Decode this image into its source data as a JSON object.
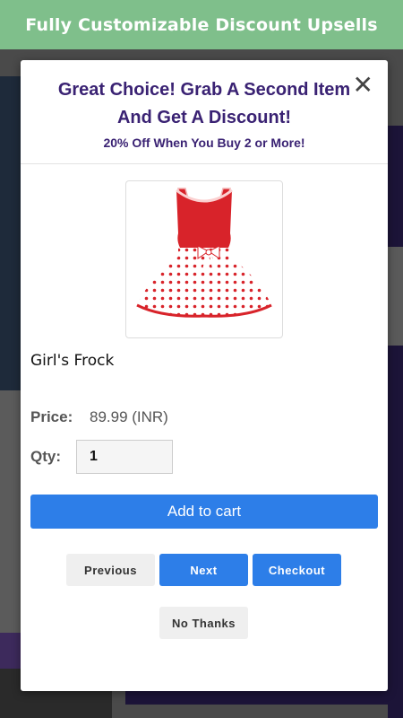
{
  "banner": {
    "title": "Fully Customizable Discount Upsells"
  },
  "modal": {
    "close_symbol": "✕",
    "headline": "Great Choice! Grab A Second Item And Get A Discount!",
    "subline": "20% Off When You Buy 2 or More!",
    "product": {
      "name": "Girl's Frock",
      "image_icon": "girls-frock-image",
      "price_label": "Price:",
      "price_value": "89.99 (INR)",
      "qty_label": "Qty:",
      "qty_value": "1"
    },
    "buttons": {
      "add_to_cart": "Add to cart",
      "previous": "Previous",
      "next": "Next",
      "checkout": "Checkout",
      "no_thanks": "No Thanks"
    }
  },
  "colors": {
    "banner_bg": "#7fbf8b",
    "headline": "#3a2273",
    "primary_button": "#2d7ee8",
    "secondary_button": "#efefef"
  }
}
